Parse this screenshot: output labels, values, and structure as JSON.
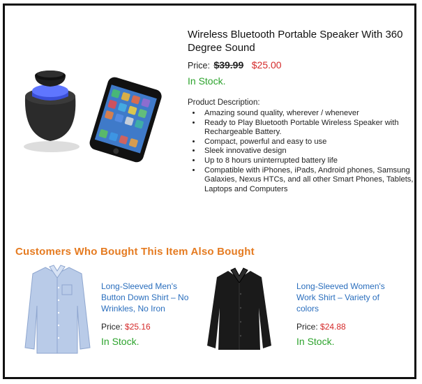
{
  "product": {
    "title": "Wireless Bluetooth Portable Speaker With 360 Degree Sound",
    "price_label": "Price:",
    "old_price": "$39.99",
    "new_price": "$25.00",
    "stock": "In Stock.",
    "description_title": "Product Description:",
    "bullets": [
      "Amazing sound quality, wherever / whenever",
      "Ready to Play Bluetooth Portable Wireless Speaker with Rechargeable Battery.",
      "Compact, powerful and easy to use",
      "Sleek innovative design",
      "Up to 8 hours uninterrupted battery life",
      "Compatible with iPhones, iPads, Android phones, Samsung Galaxies, Nexus HTCs, and all other Smart Phones, Tablets, Laptops and Computers"
    ]
  },
  "recommendations": {
    "title": "Customers Who Bought This Item Also Bought",
    "items": [
      {
        "name": "Long-Sleeved Men's Button Down Shirt – No Wrinkles, No Iron",
        "price_label": "Price:",
        "price": "$25.16",
        "stock": "In Stock."
      },
      {
        "name": "Long-Sleeved Women's Work Shirt – Variety of colors",
        "price_label": "Price:",
        "price": "$24.88",
        "stock": "In Stock."
      }
    ]
  },
  "colors": {
    "accent_orange": "#e57b21",
    "price_red": "#d42a2a",
    "stock_green": "#2ca32c",
    "link_blue": "#2a6ebd"
  }
}
